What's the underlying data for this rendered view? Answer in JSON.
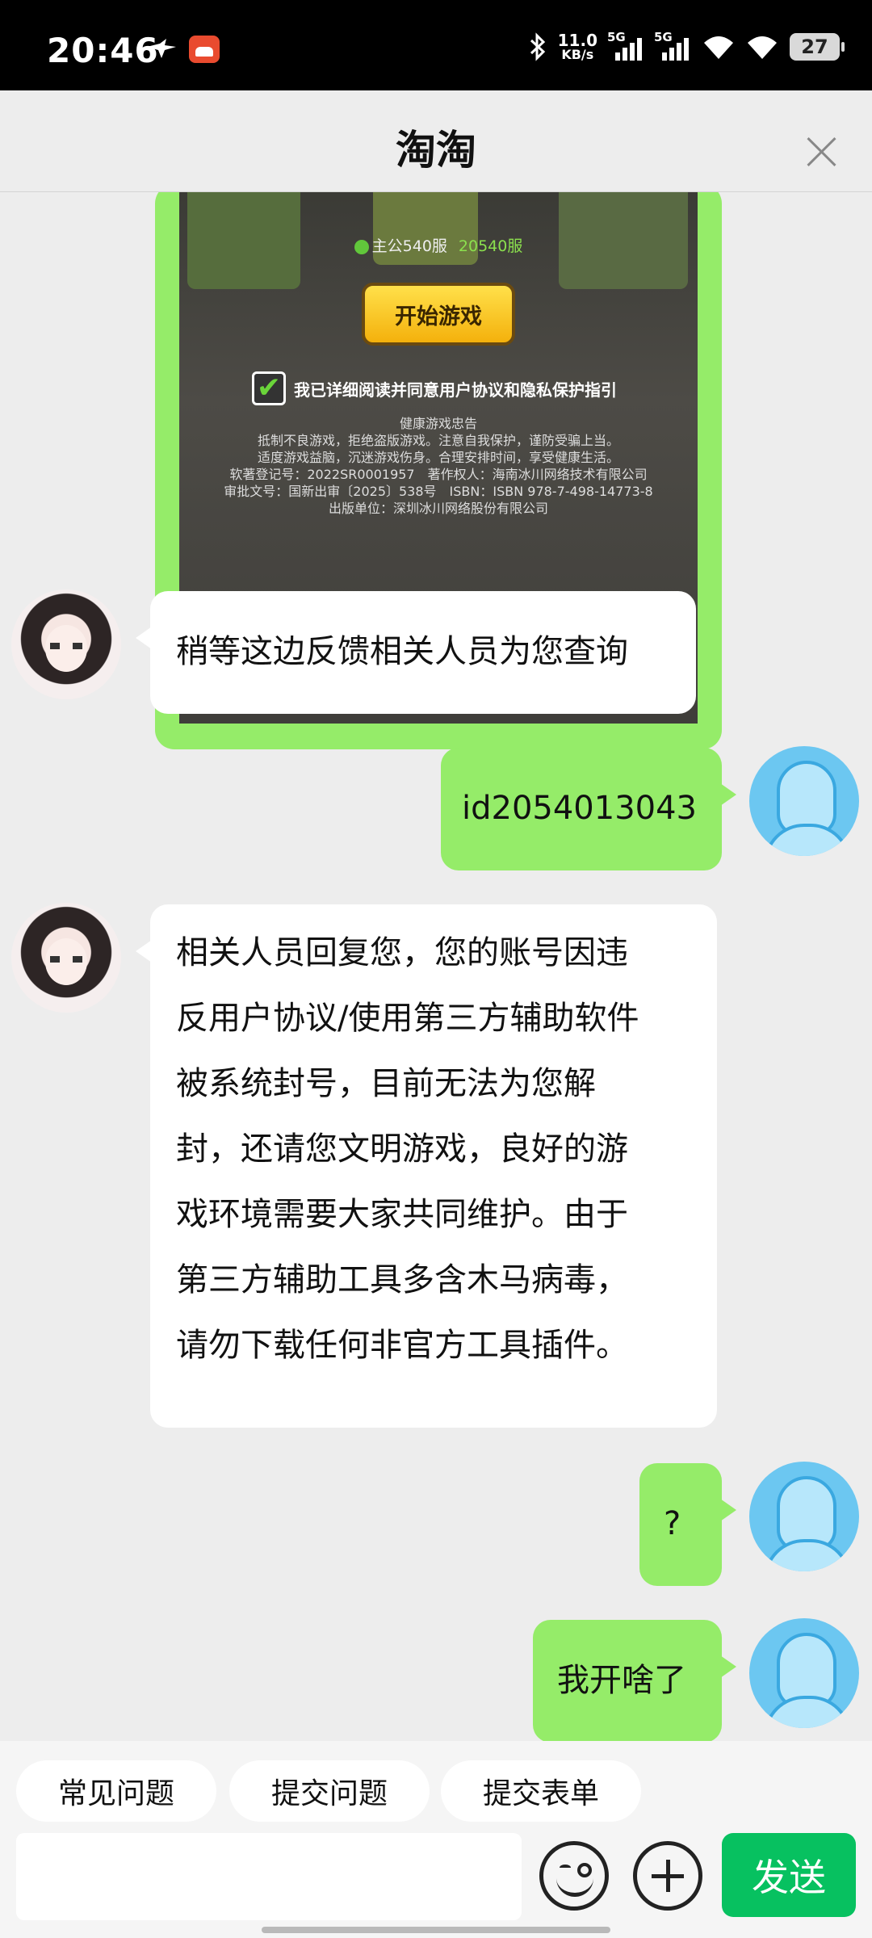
{
  "status_bar": {
    "time": "20:46",
    "net_speed_value": "11.0",
    "net_speed_unit": "KB/s",
    "sim1": "5G",
    "sim2": "5G",
    "battery": "27"
  },
  "header": {
    "title": "淘淘"
  },
  "game_screenshot": {
    "server_label": "主公540服",
    "server_num": "20540服",
    "start_button": "开始游戏",
    "agree_text": "我已详细阅读并同意用户协议和隐私保护指引",
    "notice_lines": [
      "健康游戏忠告",
      "抵制不良游戏，拒绝盗版游戏。注意自我保护，谨防受骗上当。",
      "适度游戏益脑，沉迷游戏伤身。合理安排时间，享受健康生活。",
      "软著登记号：2022SR0001957　著作权人：海南冰川网络技术有限公司",
      "审批文号：国新出审〔2025〕538号　ISBN：ISBN 978-7-498-14773-8",
      "出版单位：深圳冰川网络股份有限公司"
    ]
  },
  "messages": [
    {
      "side": "left",
      "text": "稍等这边反馈相关人员为您查询"
    },
    {
      "side": "right",
      "text": "id2054013043"
    },
    {
      "side": "left",
      "lines": [
        "相关人员回复您，您的账号因违",
        "反用户协议/使用第三方辅助软件",
        "被系统封号，目前无法为您解",
        "封，还请您文明游戏，良好的游",
        "戏环境需要大家共同维护。由于",
        "第三方辅助工具多含木马病毒，",
        "请勿下载任何非官方工具插件。"
      ]
    },
    {
      "side": "right",
      "text": "?"
    },
    {
      "side": "right",
      "text": "我开啥了"
    }
  ],
  "quick_actions": [
    "常见问题",
    "提交问题",
    "提交表单"
  ],
  "composer": {
    "input_value": "",
    "send_label": "发送"
  },
  "icons": {
    "emoji": "emoji-icon",
    "plus": "plus-icon",
    "close": "close-icon"
  }
}
